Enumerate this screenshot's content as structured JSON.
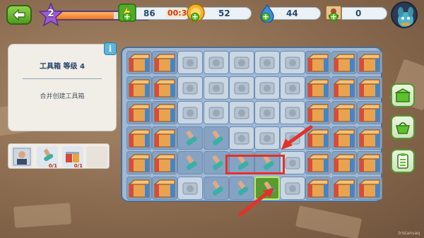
{
  "hud": {
    "level": "2",
    "level_progress": 0.62,
    "energy": "86",
    "energy_timer": "00:30",
    "coins": "52",
    "gems": "44",
    "tickets": "0"
  },
  "info_panel": {
    "title": "工具箱  等级 4",
    "description": "合并创建工具箱",
    "info_label": "i"
  },
  "items_strip": {
    "counts": [
      "",
      "0/1",
      "0/1",
      ""
    ]
  },
  "board": {
    "rows": [
      [
        "box",
        "box",
        "frost",
        "frost",
        "frost",
        "frost",
        "frost",
        "box",
        "box",
        "box"
      ],
      [
        "box",
        "box",
        "frost",
        "frost",
        "frost",
        "frost",
        "frost",
        "box",
        "box",
        "box"
      ],
      [
        "box",
        "box",
        "frost",
        "frost",
        "frost",
        "frost",
        "frost",
        "box",
        "box",
        "box"
      ],
      [
        "box",
        "box",
        "item",
        "item",
        "frost",
        "frost",
        "frost",
        "box",
        "box",
        "box"
      ],
      [
        "box",
        "box",
        "item",
        "item",
        "item",
        "item",
        "frost",
        "box",
        "box",
        "box"
      ],
      [
        "box",
        "box",
        "frost",
        "item",
        "sel",
        "sel",
        "frost",
        "box",
        "box",
        "box"
      ]
    ]
  },
  "side_buttons": [
    "box-icon",
    "basket-icon",
    "checklist-icon"
  ],
  "watermark": "tristanvaq",
  "colors": {
    "accent_green": "#5cc12b",
    "highlight_red": "#e5302a",
    "board_blue": "#9fb9d6"
  }
}
